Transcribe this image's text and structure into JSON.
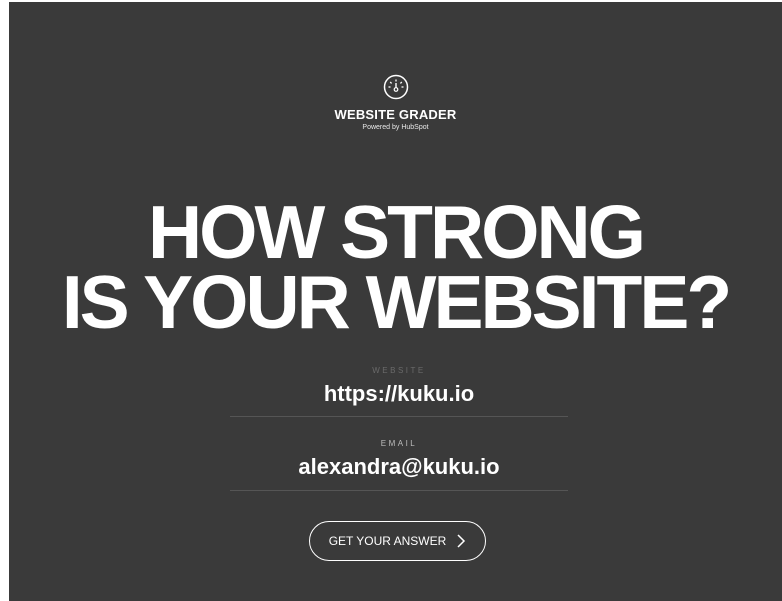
{
  "logo": {
    "icon": "speedometer-icon",
    "title": "WEBSITE GRADER",
    "subtitle": "Powered by HubSpot"
  },
  "headline": {
    "line1": "HOW STRONG",
    "line2": "IS YOUR WEBSITE?"
  },
  "form": {
    "website": {
      "label": "WEBSITE",
      "value": "https://kuku.io"
    },
    "email": {
      "label": "EMAIL",
      "value": "alexandra@kuku.io"
    },
    "submit": {
      "label": "GET YOUR ANSWER",
      "icon": "chevron-right-icon"
    }
  },
  "colors": {
    "background": "#3a3a3a",
    "text": "#ffffff",
    "divider": "#555555"
  }
}
